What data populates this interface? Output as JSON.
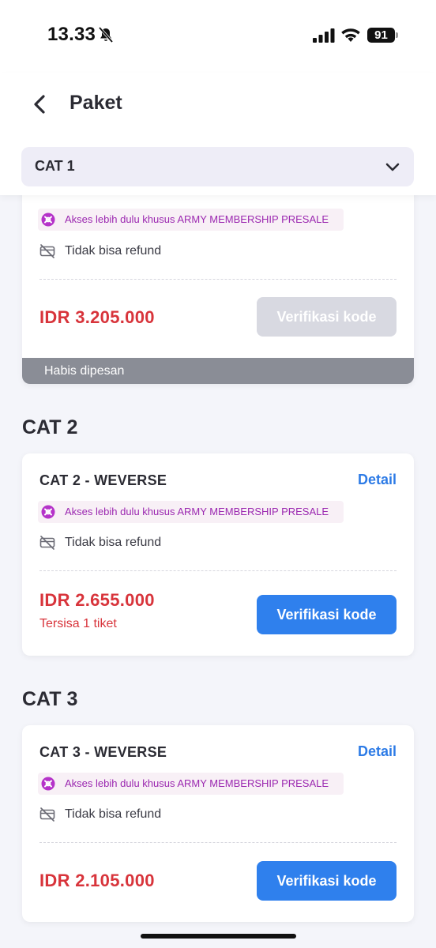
{
  "status_bar": {
    "time": "13.33",
    "battery": "91"
  },
  "header": {
    "title": "Paket",
    "selected_category": "CAT 1"
  },
  "sections": [
    {
      "title": "",
      "cards": [
        {
          "title": "",
          "detail_label": "",
          "badge": "Akses lebih dulu khusus ARMY MEMBERSHIP PRESALE",
          "refund": "Tidak bisa refund",
          "price": "IDR 3.205.000",
          "stock": "",
          "button": "Verifikasi kode",
          "soldout": "Habis dipesan"
        }
      ]
    },
    {
      "title": "CAT 2",
      "cards": [
        {
          "title": "CAT 2 - WEVERSE",
          "detail_label": "Detail",
          "badge": "Akses lebih dulu khusus ARMY MEMBERSHIP PRESALE",
          "refund": "Tidak bisa refund",
          "price": "IDR 2.655.000",
          "stock": "Tersisa 1 tiket",
          "button": "Verifikasi kode"
        }
      ]
    },
    {
      "title": "CAT 3",
      "cards": [
        {
          "title": "CAT 3 - WEVERSE",
          "detail_label": "Detail",
          "badge": "Akses lebih dulu khusus ARMY MEMBERSHIP PRESALE",
          "refund": "Tidak bisa refund",
          "price": "IDR 2.105.000",
          "stock": "",
          "button": "Verifikasi kode"
        }
      ]
    }
  ],
  "colors": {
    "accent": "#2f80ed",
    "price": "#d8343b",
    "badge_text": "#9b28b0",
    "badge_icon": "#b533c9",
    "soldout_bar": "#8a8d96"
  },
  "icons": [
    "bell-muted-icon",
    "signal-icon",
    "wifi-icon",
    "battery-icon",
    "back-chevron-icon",
    "chevron-down-icon",
    "membership-icon",
    "no-refund-icon"
  ]
}
